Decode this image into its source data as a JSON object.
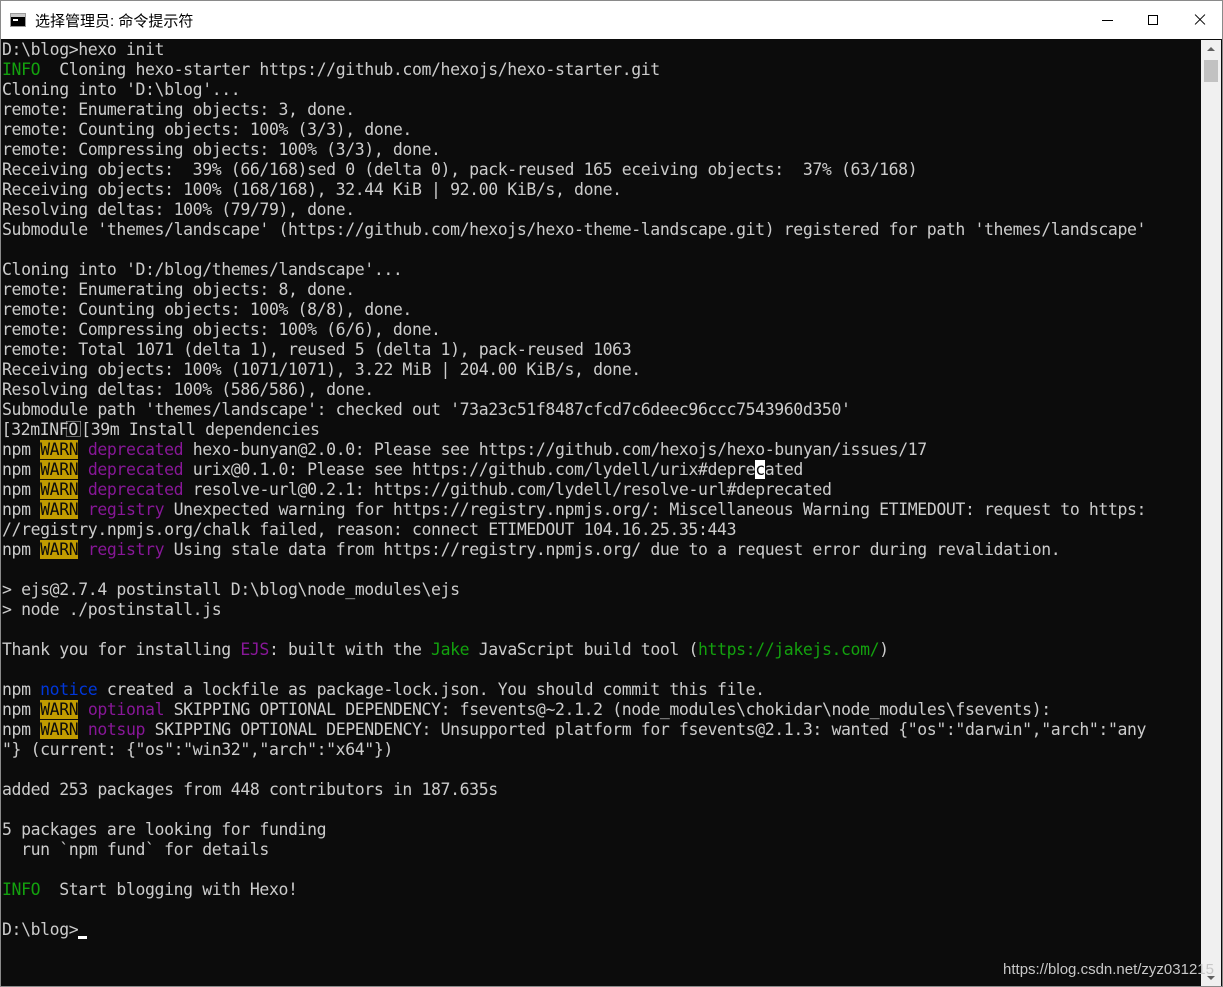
{
  "window": {
    "title": "选择管理员: 命令提示符"
  },
  "console": {
    "lines": [
      [
        {
          "t": "D:\\blog>hexo init"
        }
      ],
      [
        {
          "t": "INFO",
          "c": "green"
        },
        {
          "t": "  Cloning hexo-starter https://github.com/hexojs/hexo-starter.git"
        }
      ],
      [
        {
          "t": "Cloning into 'D:\\blog'..."
        }
      ],
      [
        {
          "t": "remote: Enumerating objects: 3, done."
        }
      ],
      [
        {
          "t": "remote: Counting objects: 100% (3/3), done."
        }
      ],
      [
        {
          "t": "remote: Compressing objects: 100% (3/3), done."
        }
      ],
      [
        {
          "t": "Receiving objects:  39% (66/168)sed 0 (delta 0), pack-reused 165 eceiving objects:  37% (63/168)"
        }
      ],
      [
        {
          "t": "Receiving objects: 100% (168/168), 32.44 KiB | 92.00 KiB/s, done."
        }
      ],
      [
        {
          "t": "Resolving deltas: 100% (79/79), done."
        }
      ],
      [
        {
          "t": "Submodule 'themes/landscape' (https://github.com/hexojs/hexo-theme-landscape.git) registered for path 'themes/landscape'"
        }
      ],
      [
        {
          "t": ""
        }
      ],
      [
        {
          "t": "Cloning into 'D:/blog/themes/landscape'..."
        }
      ],
      [
        {
          "t": "remote: Enumerating objects: 8, done."
        }
      ],
      [
        {
          "t": "remote: Counting objects: 100% (8/8), done."
        }
      ],
      [
        {
          "t": "remote: Compressing objects: 100% (6/6), done."
        }
      ],
      [
        {
          "t": "remote: Total 1071 (delta 1), reused 5 (delta 1), pack-reused 1063"
        }
      ],
      [
        {
          "t": "Receiving objects: 100% (1071/1071), 3.22 MiB | 204.00 KiB/s, done."
        }
      ],
      [
        {
          "t": "Resolving deltas: 100% (586/586), done."
        }
      ],
      [
        {
          "t": "Submodule path 'themes/landscape': checked out '73a23c51f8487cfcd7c6deec96ccc7543960d350'"
        }
      ],
      [
        {
          "t": "⃞[32mINFO ⃞[39m Install dependencies"
        }
      ],
      [
        {
          "t": "npm "
        },
        {
          "t": "WARN",
          "c": "warn"
        },
        {
          "t": " "
        },
        {
          "t": "deprecated",
          "c": "magenta"
        },
        {
          "t": " hexo-bunyan@2.0.0: Please see https://github.com/hexojs/hexo-bunyan/issues/17"
        }
      ],
      [
        {
          "t": "npm "
        },
        {
          "t": "WARN",
          "c": "warn"
        },
        {
          "t": " "
        },
        {
          "t": "deprecated",
          "c": "magenta"
        },
        {
          "t": " urix@0.1.0: Please see https://github.com/lydell/urix#depre"
        },
        {
          "t": "c",
          "c": "cursor-block"
        },
        {
          "t": "ated"
        }
      ],
      [
        {
          "t": "npm "
        },
        {
          "t": "WARN",
          "c": "warn"
        },
        {
          "t": " "
        },
        {
          "t": "deprecated",
          "c": "magenta"
        },
        {
          "t": " resolve-url@0.2.1: https://github.com/lydell/resolve-url#deprecated"
        }
      ],
      [
        {
          "t": "npm "
        },
        {
          "t": "WARN",
          "c": "warn"
        },
        {
          "t": " "
        },
        {
          "t": "registry",
          "c": "magenta"
        },
        {
          "t": " Unexpected warning for https://registry.npmjs.org/: Miscellaneous Warning ETIMEDOUT: request to https:"
        }
      ],
      [
        {
          "t": "//registry.npmjs.org/chalk failed, reason: connect ETIMEDOUT 104.16.25.35:443"
        }
      ],
      [
        {
          "t": "npm "
        },
        {
          "t": "WARN",
          "c": "warn"
        },
        {
          "t": " "
        },
        {
          "t": "registry",
          "c": "magenta"
        },
        {
          "t": " Using stale data from https://registry.npmjs.org/ due to a request error during revalidation."
        }
      ],
      [
        {
          "t": ""
        }
      ],
      [
        {
          "t": "> ejs@2.7.4 postinstall D:\\blog\\node_modules\\ejs"
        }
      ],
      [
        {
          "t": "> node ./postinstall.js"
        }
      ],
      [
        {
          "t": ""
        }
      ],
      [
        {
          "t": "Thank you for installing "
        },
        {
          "t": "EJS",
          "c": "magenta"
        },
        {
          "t": ": built with the "
        },
        {
          "t": "Jake",
          "c": "green"
        },
        {
          "t": " JavaScript build tool ("
        },
        {
          "t": "https://jakejs.com/",
          "c": "green"
        },
        {
          "t": ")"
        }
      ],
      [
        {
          "t": ""
        }
      ],
      [
        {
          "t": "npm "
        },
        {
          "t": "notice",
          "c": "blue"
        },
        {
          "t": " created a lockfile as package-lock.json. You should commit this file."
        }
      ],
      [
        {
          "t": "npm "
        },
        {
          "t": "WARN",
          "c": "warn"
        },
        {
          "t": " "
        },
        {
          "t": "optional",
          "c": "magenta"
        },
        {
          "t": " SKIPPING OPTIONAL DEPENDENCY: fsevents@~2.1.2 (node_modules\\chokidar\\node_modules\\fsevents):"
        }
      ],
      [
        {
          "t": "npm "
        },
        {
          "t": "WARN",
          "c": "warn"
        },
        {
          "t": " "
        },
        {
          "t": "notsup",
          "c": "magenta"
        },
        {
          "t": " SKIPPING OPTIONAL DEPENDENCY: Unsupported platform for fsevents@2.1.3: wanted {\"os\":\"darwin\",\"arch\":\"any"
        }
      ],
      [
        {
          "t": "\"} (current: {\"os\":\"win32\",\"arch\":\"x64\"})"
        }
      ],
      [
        {
          "t": ""
        }
      ],
      [
        {
          "t": "added 253 packages from 448 contributors in 187.635s"
        }
      ],
      [
        {
          "t": ""
        }
      ],
      [
        {
          "t": "5 packages are looking for funding"
        }
      ],
      [
        {
          "t": "  run `npm fund` for details"
        }
      ],
      [
        {
          "t": ""
        }
      ],
      [
        {
          "t": "INFO",
          "c": "green"
        },
        {
          "t": "  Start blogging with Hexo!"
        }
      ],
      [
        {
          "t": ""
        }
      ],
      [
        {
          "t": "D:\\blog>"
        },
        {
          "t": "",
          "c": "cursor"
        }
      ]
    ]
  },
  "watermark": "https://blog.csdn.net/zyz031215",
  "colors": {
    "background": "#0c0c0c",
    "foreground": "#cccccc",
    "green": "#13a10e",
    "warn_bg": "#c19c00",
    "magenta": "#881798",
    "blue": "#0037da"
  },
  "icons": {
    "app": "cmd-icon",
    "minimize": "minimize-icon",
    "maximize": "maximize-icon",
    "close": "close-icon"
  }
}
